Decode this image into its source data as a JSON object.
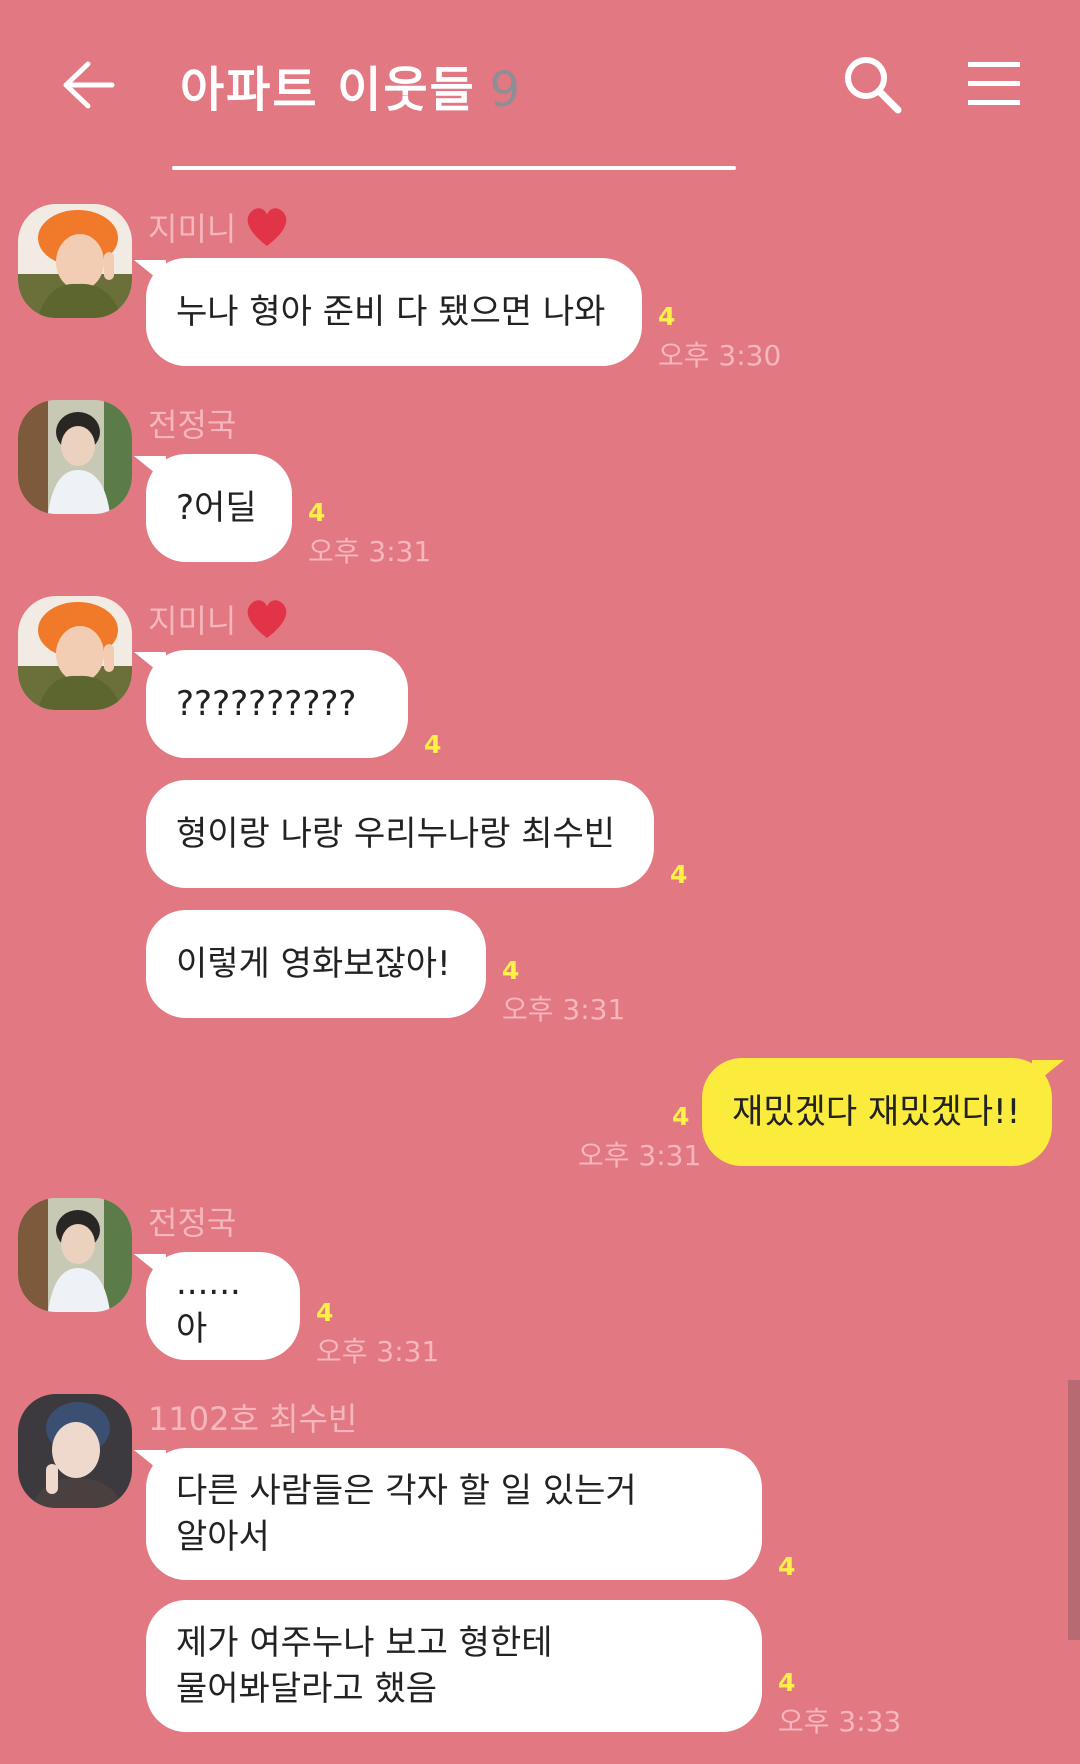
{
  "header": {
    "title": "아파트 이웃들",
    "member_count": "9",
    "back_icon": "arrow-left-icon",
    "search_icon": "search-icon",
    "menu_icon": "hamburger-menu-icon"
  },
  "colors": {
    "background": "#e27882",
    "bubble_other": "#ffffff",
    "bubble_me": "#fbeb3d",
    "unread": "#fff04a",
    "meta_text": "#f5b6bd"
  },
  "messages": [
    {
      "sender": "지미니",
      "sender_icon": "heart-icon",
      "text": "누나 형아 준비 다 됐으면 나와",
      "unread": "4",
      "time": "오후 3:30"
    },
    {
      "sender": "전정국",
      "text": "?어딜",
      "unread": "4",
      "time": "오후 3:31"
    },
    {
      "sender": "지미니",
      "sender_icon": "heart-icon",
      "text": "??????????",
      "unread": "4"
    },
    {
      "text": "형이랑 나랑 우리누나랑 최수빈",
      "unread": "4"
    },
    {
      "text": "이렇게 영화보잖아!",
      "unread": "4",
      "time": "오후 3:31"
    },
    {
      "sender": "me",
      "text": "재밌겠다 재밌겠다!!",
      "unread": "4",
      "time": "오후 3:31"
    },
    {
      "sender": "전정국",
      "text": "......아",
      "unread": "4",
      "time": "오후 3:31"
    },
    {
      "sender": "1102호 최수빈",
      "text": "다른 사람들은 각자 할 일 있는거\n알아서",
      "unread": "4"
    },
    {
      "text": "제가 여주누나 보고 형한테\n물어봐달라고 했음",
      "unread": "4",
      "time": "오후 3:33"
    }
  ]
}
